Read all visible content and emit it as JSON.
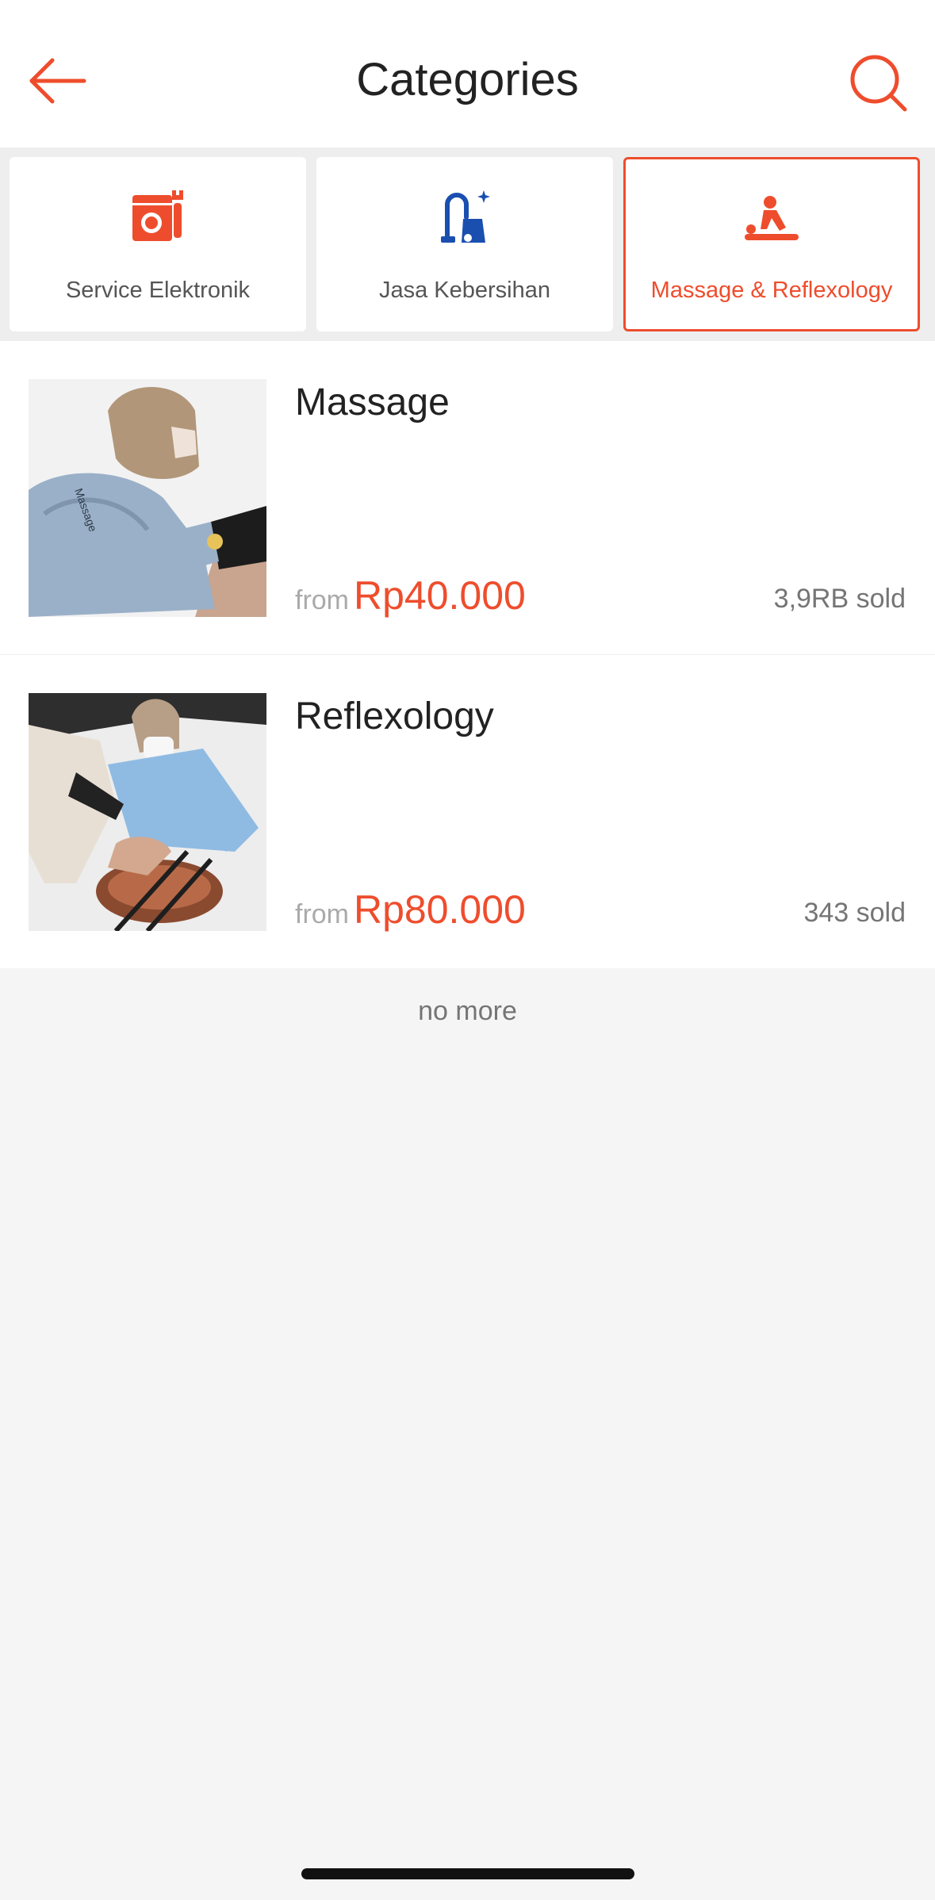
{
  "header": {
    "title": "Categories",
    "back_icon": "arrow-left-icon",
    "search_icon": "search-icon"
  },
  "categories": [
    {
      "label": "Service Elektronik",
      "icon": "washing-machine-wrench-icon",
      "active": false
    },
    {
      "label": "Jasa Kebersihan",
      "icon": "vacuum-cleaner-icon",
      "active": false
    },
    {
      "label": "Massage & Reflexology",
      "icon": "massage-icon",
      "active": true
    }
  ],
  "items": [
    {
      "name": "Massage",
      "from": "from",
      "price": "Rp40.000",
      "sold": "3,9RB sold"
    },
    {
      "name": "Reflexology",
      "from": "from",
      "price": "Rp80.000",
      "sold": "343 sold"
    }
  ],
  "footer": {
    "no_more": "no more"
  },
  "colors": {
    "accent": "#ee4d2d",
    "blue_icon": "#1a4fb0"
  }
}
